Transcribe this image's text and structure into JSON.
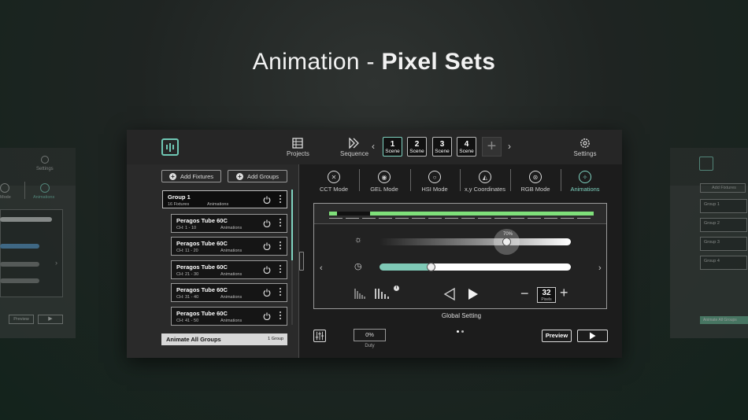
{
  "headline": {
    "light": "Animation - ",
    "bold": "Pixel Sets"
  },
  "nav": {
    "projects": "Projects",
    "sequence": "Sequence",
    "settings": "Settings",
    "scene_label": "Scene",
    "scenes": [
      "1",
      "2",
      "3",
      "4"
    ],
    "active_scene": "1"
  },
  "left": {
    "add_fixtures": "Add Fixtures",
    "add_groups": "Add Groups",
    "group": {
      "name": "Group 1",
      "count": "16 Fixtures",
      "mode": "Animations"
    },
    "fixtures": [
      {
        "name": "Peragos Tube 60C",
        "ch": "CH: 1 - 10",
        "mode": "Animations"
      },
      {
        "name": "Peragos Tube 60C",
        "ch": "CH: 11 - 20",
        "mode": "Animations"
      },
      {
        "name": "Peragos Tube 60C",
        "ch": "CH: 21 - 30",
        "mode": "Animations"
      },
      {
        "name": "Peragos Tube 60C",
        "ch": "CH: 31 - 40",
        "mode": "Animations"
      },
      {
        "name": "Peragos Tube 60C",
        "ch": "CH: 41 - 50",
        "mode": "Animations"
      }
    ],
    "animate_all": "Animate All Groups",
    "animate_count": "1 Group"
  },
  "modes": [
    "CCT Mode",
    "GEL Mode",
    "HSI Mode",
    "x,y Coordinates",
    "RGB Mode",
    "Animations"
  ],
  "active_mode": "Animations",
  "panel": {
    "brightness_pct": "70%",
    "brightness_value": 0.7,
    "speed_value": 0.27,
    "pixels_value": "32",
    "pixels_label": "Pixels",
    "global_setting": "Global Setting",
    "duty_value": "0%",
    "duty_label": "Duty",
    "preview": "Preview"
  },
  "pixel_strip": {
    "lit_segments": [
      [
        0,
        3
      ],
      [
        14,
        100
      ]
    ]
  },
  "colors": {
    "accent": "#7fd3c1",
    "pixel_on": "#7fe07a"
  },
  "ghost_left": {
    "settings": "Settings",
    "mode": "Mode",
    "animations": "Animations",
    "preview": "Preview"
  },
  "ghost_right": {
    "add_fixtures": "Add Fixtures",
    "groups": [
      "Group 1",
      "Group 2",
      "Group 3",
      "Group 4"
    ],
    "animate_all": "Animate All Groups"
  }
}
